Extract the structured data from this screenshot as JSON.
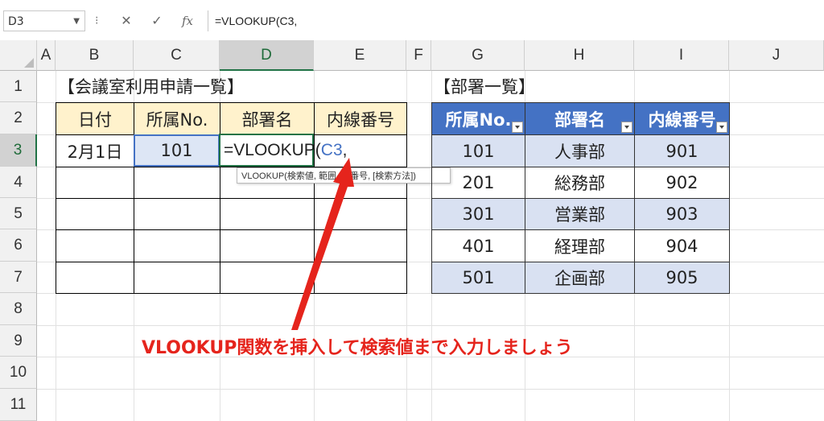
{
  "formula_bar": {
    "name_box": "D3",
    "cancel_icon": "✕",
    "enter_icon": "✓",
    "fx_label": "fx",
    "formula": "=VLOOKUP(C3,"
  },
  "columns": [
    "A",
    "B",
    "C",
    "D",
    "E",
    "F",
    "G",
    "H",
    "I",
    "J"
  ],
  "rows": [
    "1",
    "2",
    "3",
    "4",
    "5",
    "6",
    "7",
    "8",
    "9",
    "10",
    "11"
  ],
  "selected_column": "D",
  "selected_row": "3",
  "left_table": {
    "title": "【会議室利用申請一覧】",
    "headers": [
      "日付",
      "所属No.",
      "部署名",
      "内線番号"
    ],
    "row3": {
      "date": "2月1日",
      "dept_no": "101"
    }
  },
  "editing": {
    "prefix": "=VLOOKUP(",
    "ref": "C3",
    "suffix": ","
  },
  "tooltip": "VLOOKUP(検索値, 範囲, 列番号, [検索方法])",
  "right_table": {
    "title": "【部署一覧】",
    "headers": [
      "所属No.",
      "部署名",
      "内線番号"
    ],
    "rows": [
      {
        "no": "101",
        "name": "人事部",
        "ext": "901"
      },
      {
        "no": "201",
        "name": "総務部",
        "ext": "902"
      },
      {
        "no": "301",
        "name": "営業部",
        "ext": "903"
      },
      {
        "no": "401",
        "name": "経理部",
        "ext": "904"
      },
      {
        "no": "501",
        "name": "企画部",
        "ext": "905"
      }
    ]
  },
  "annotation": {
    "text": "VLOOKUP関数を挿入して検索値まで入力しましょう",
    "color": "#e5241c"
  },
  "colors": {
    "header_yellow": "#fff2cc",
    "table_blue": "#4472c4",
    "band_blue": "#d9e1f2",
    "excel_green": "#217346"
  }
}
